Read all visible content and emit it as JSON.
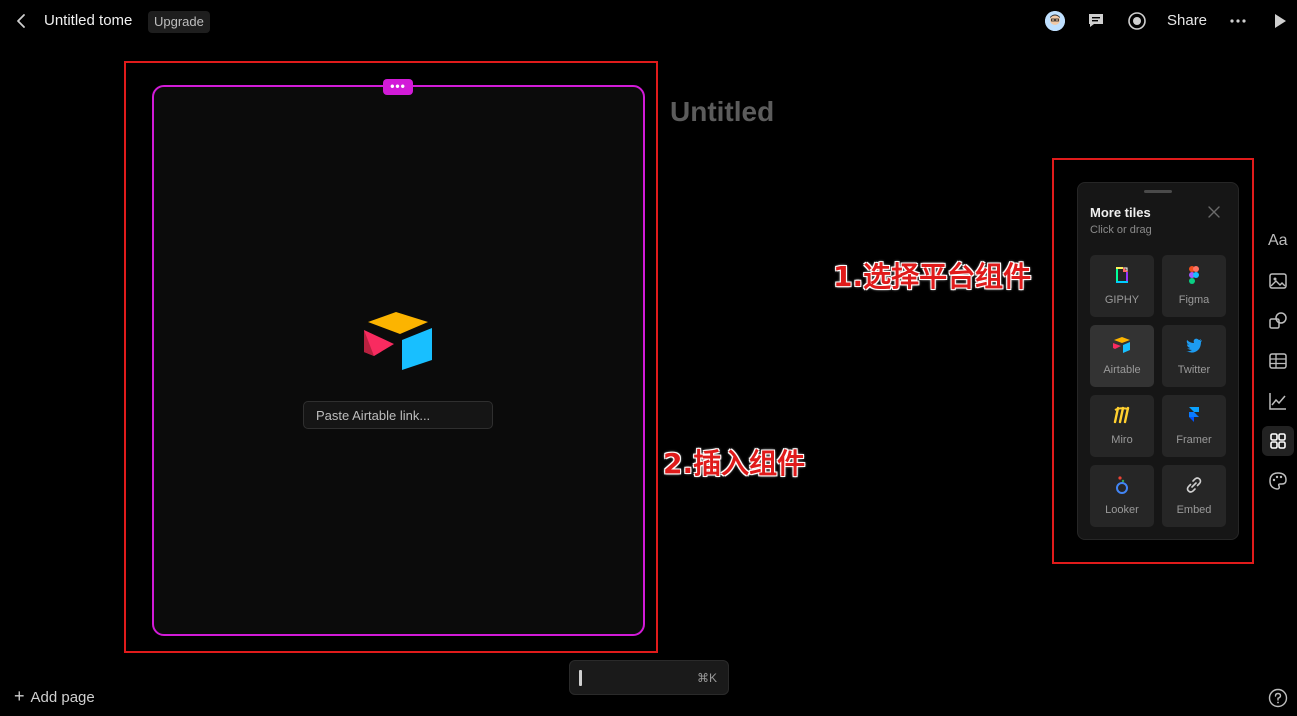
{
  "header": {
    "title": "Untitled tome",
    "upgrade_label": "Upgrade",
    "share_label": "Share"
  },
  "page": {
    "heading": "Untitled"
  },
  "card": {
    "handle_label": "•••",
    "placeholder": "Paste Airtable link..."
  },
  "annotations": {
    "step1": "1.选择平台组件",
    "step2": "2.插入组件"
  },
  "tiles_panel": {
    "title": "More tiles",
    "subtitle": "Click or drag",
    "tiles": [
      {
        "label": "GIPHY",
        "icon": "giphy-icon"
      },
      {
        "label": "Figma",
        "icon": "figma-icon"
      },
      {
        "label": "Airtable",
        "icon": "airtable-icon"
      },
      {
        "label": "Twitter",
        "icon": "twitter-icon"
      },
      {
        "label": "Miro",
        "icon": "miro-icon"
      },
      {
        "label": "Framer",
        "icon": "framer-icon"
      },
      {
        "label": "Looker",
        "icon": "looker-icon"
      },
      {
        "label": "Embed",
        "icon": "link-icon"
      }
    ]
  },
  "right_rail": {
    "text_icon_label": "Aa"
  },
  "command_bar": {
    "shortcut": "⌘K"
  },
  "footer": {
    "add_page_label": "Add page"
  },
  "colors": {
    "background": "#000000",
    "selection_accent": "#d21bd8",
    "annotation_red": "#e01b1b"
  }
}
